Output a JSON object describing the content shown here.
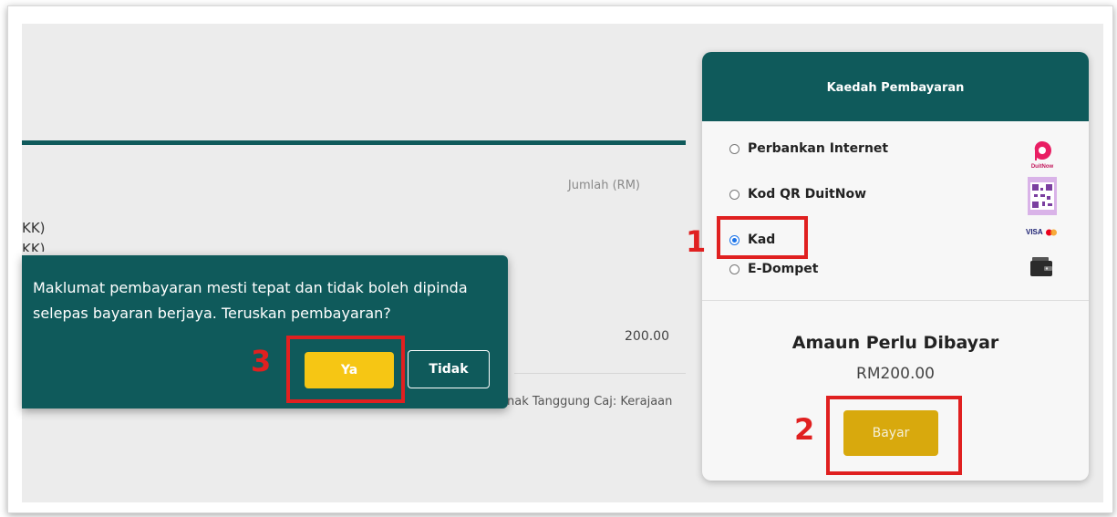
{
  "background": {
    "column_header": "Jumlah (RM)",
    "fragment_1": "KK)",
    "fragment_2": "KK)",
    "row_amount": "200.00",
    "charge_text": "nak Tanggung Caj: Kerajaan"
  },
  "dialog": {
    "message": "Maklumat pembayaran mesti tepat dan tidak boleh dipinda selepas bayaran berjaya. Teruskan pembayaran?",
    "yes_label": "Ya",
    "no_label": "Tidak"
  },
  "payment_panel": {
    "title": "Kaedah Pembayaran",
    "options": [
      {
        "label": "Perbankan Internet",
        "selected": false,
        "icon": "duitnow-bank-icon"
      },
      {
        "label": "Kod QR DuitNow",
        "selected": false,
        "icon": "qr-code-icon"
      },
      {
        "label": "Kad",
        "selected": true,
        "icon": "visa-mastercard-icon"
      },
      {
        "label": "E-Dompet",
        "selected": false,
        "icon": "wallet-icon"
      }
    ],
    "duitnow_logo_text": "DuitNow",
    "visa_text": "VISA",
    "amount_title": "Amaun Perlu Dibayar",
    "amount_value": "RM200.00",
    "pay_button": "Bayar"
  },
  "annotations": [
    {
      "label": "1"
    },
    {
      "label": "2"
    },
    {
      "label": "3"
    }
  ],
  "colors": {
    "primary": "#0f5a5b",
    "accent_yellow": "#f6c614",
    "pay_button": "#d8a90d",
    "annotation_red": "#e02020"
  }
}
